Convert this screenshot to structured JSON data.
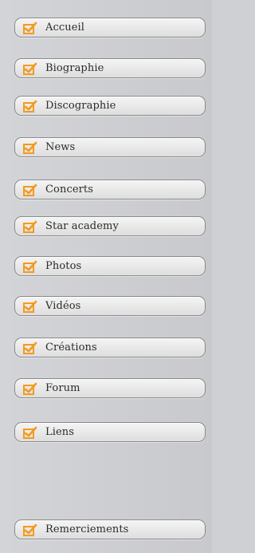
{
  "menu": {
    "accent_color": "#f39a1e",
    "items": [
      {
        "label": "Accueil",
        "icon": "checkmark-icon"
      },
      {
        "label": "Biographie",
        "icon": "checkmark-icon"
      },
      {
        "label": "Discographie",
        "icon": "checkmark-icon"
      },
      {
        "label": "News",
        "icon": "checkmark-icon"
      },
      {
        "label": "Concerts",
        "icon": "checkmark-icon"
      },
      {
        "label": "Star academy",
        "icon": "checkmark-icon"
      },
      {
        "label": "Photos",
        "icon": "checkmark-icon"
      },
      {
        "label": "Vidéos",
        "icon": "checkmark-icon"
      },
      {
        "label": "Créations",
        "icon": "checkmark-icon"
      },
      {
        "label": "Forum",
        "icon": "checkmark-icon"
      },
      {
        "label": "Liens",
        "icon": "checkmark-icon"
      },
      {
        "label": "Remerciements",
        "icon": "checkmark-icon"
      }
    ]
  }
}
